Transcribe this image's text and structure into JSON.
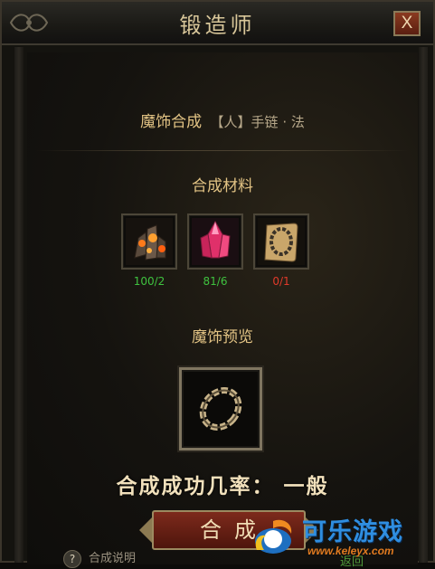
{
  "window": {
    "title": "锻造师",
    "close_label": "X"
  },
  "item": {
    "label": "魔饰合成",
    "value": "【人】手链 · 法"
  },
  "materials": {
    "heading": "合成材料",
    "items": [
      {
        "icon": "ore-crystal-icon",
        "count": "100/2",
        "color": "#3fc23f"
      },
      {
        "icon": "pink-crystal-icon",
        "count": "81/6",
        "color": "#3fc23f"
      },
      {
        "icon": "bracelet-scroll-icon",
        "count": "0/1",
        "color": "#e23a2a"
      }
    ]
  },
  "preview": {
    "heading": "魔饰预览",
    "icon": "bracelet-icon"
  },
  "rate": {
    "text": "合成成功几率： 一般"
  },
  "actions": {
    "combine_label": "合成",
    "help_label": "合成说明",
    "help_icon": "?",
    "hint_text": "返回"
  },
  "watermark": {
    "name": "可乐游戏",
    "url": "www.keleyx.com"
  }
}
